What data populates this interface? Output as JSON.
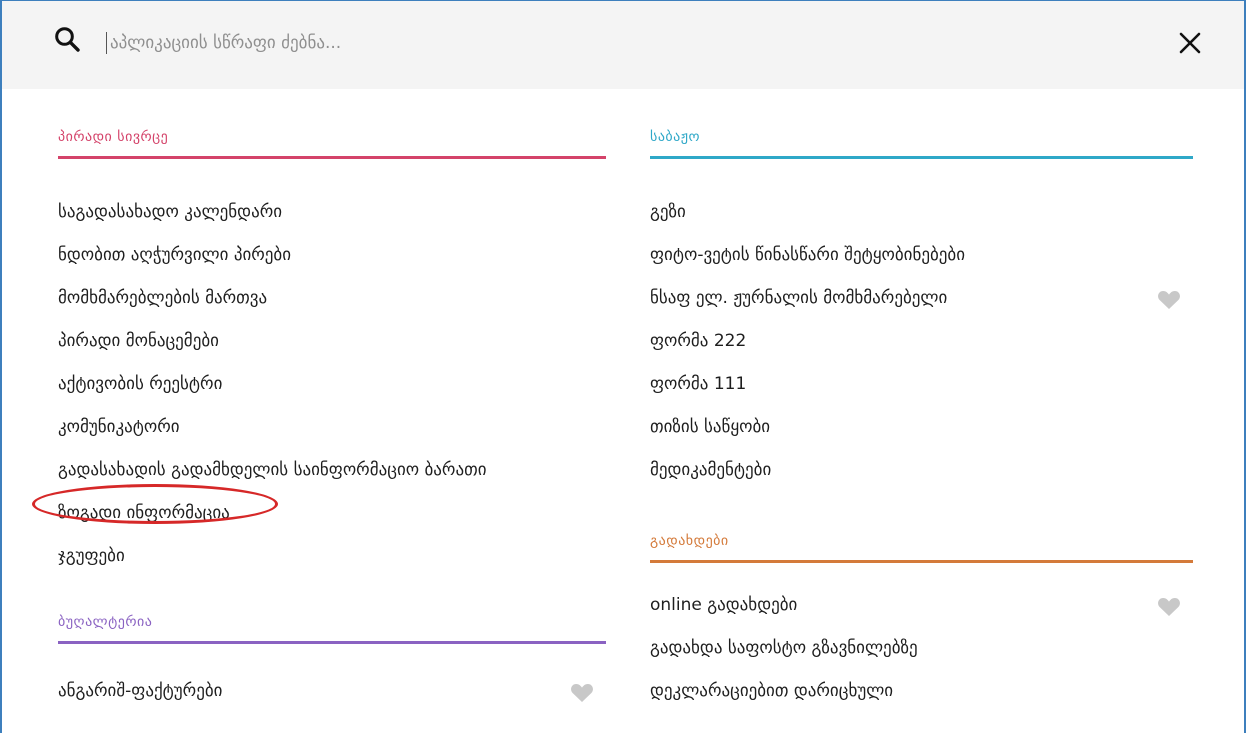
{
  "search": {
    "placeholder": "აპლიკაციის სწრაფი ძებნა...",
    "value": ""
  },
  "colors": {
    "personal": "#d4436a",
    "general": "#2fa8c8",
    "accounting": "#8a62c2",
    "payments": "#d47a3a",
    "heart": "#c8c8c8",
    "highlight": "#d62828"
  },
  "sections": {
    "personal": {
      "title": "პირადი სივრცე",
      "items": [
        "საგადასახადო კალენდარი",
        "ნდობით აღჭურვილი პირები",
        "მომხმარებლების მართვა",
        "პირადი მონაცემები",
        "აქტივობის რეესტრი",
        "კომუნიკატორი",
        "გადასახადის გადამხდელის საინფორმაციო ბარათი",
        "ზოგადი ინფორმაცია",
        "ჯგუფები"
      ]
    },
    "accounting": {
      "title": "ბუღალტერია",
      "items": [
        "ანგარიშ-ფაქტურები"
      ]
    },
    "general": {
      "title": "საბაჟო",
      "items": [
        "გეზი",
        "ფიტო-ვეტის წინასწარი შეტყობინებები",
        "ნსაფ ელ. ჟურნალის მომხმარებელი",
        "ფორმა 222",
        "ფორმა 111",
        "თიზის საწყობი",
        "მედიკამენტები"
      ]
    },
    "payments": {
      "title": "გადახდები",
      "items": [
        "online გადახდები",
        "გადახდა საფოსტო გზავნილებზე",
        "დეკლარაციებით დარიცხული"
      ]
    }
  },
  "icons": {
    "search": "search-icon",
    "close": "close-icon",
    "favorite": "heart-icon"
  }
}
